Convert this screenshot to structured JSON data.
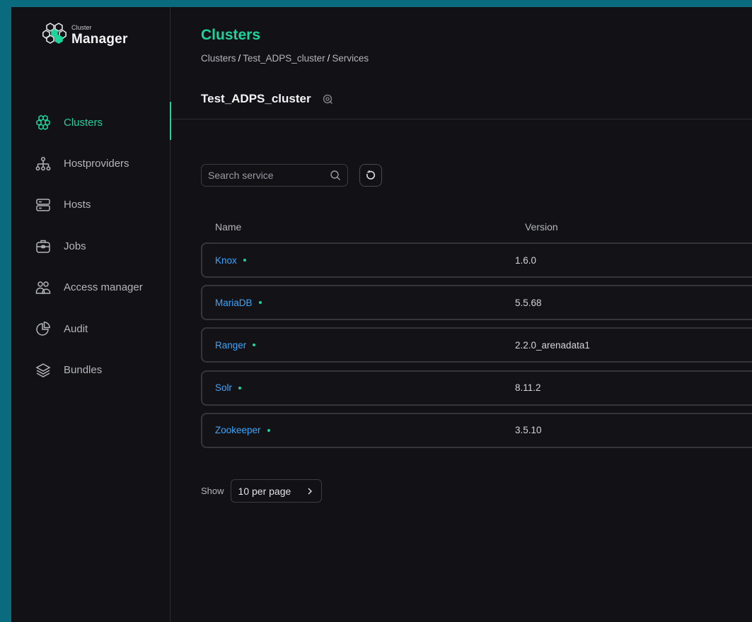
{
  "app": {
    "logo_small": "Cluster",
    "logo_big": "Manager"
  },
  "sidebar": {
    "items": [
      {
        "label": "Clusters",
        "icon": "clusters-icon",
        "active": true
      },
      {
        "label": "Hostproviders",
        "icon": "hostproviders-icon",
        "active": false
      },
      {
        "label": "Hosts",
        "icon": "hosts-icon",
        "active": false
      },
      {
        "label": "Jobs",
        "icon": "jobs-icon",
        "active": false
      },
      {
        "label": "Access manager",
        "icon": "access-manager-icon",
        "active": false
      },
      {
        "label": "Audit",
        "icon": "audit-icon",
        "active": false
      },
      {
        "label": "Bundles",
        "icon": "bundles-icon",
        "active": false
      }
    ]
  },
  "header": {
    "title": "Clusters",
    "breadcrumb": [
      "Clusters",
      "Test_ADPS_cluster",
      "Services"
    ],
    "breadcrumb_sep": "/"
  },
  "cluster": {
    "name": "Test_ADPS_cluster"
  },
  "search": {
    "placeholder": "Search service"
  },
  "table": {
    "columns": [
      "Name",
      "Version"
    ],
    "rows": [
      {
        "name": "Knox",
        "version": "1.6.0"
      },
      {
        "name": "MariaDB",
        "version": "5.5.68"
      },
      {
        "name": "Ranger",
        "version": "2.2.0_arenadata1"
      },
      {
        "name": "Solr",
        "version": "8.11.2"
      },
      {
        "name": "Zookeeper",
        "version": "3.5.10"
      }
    ]
  },
  "pagination": {
    "show_label": "Show",
    "per_page": "10 per page"
  },
  "colors": {
    "accent": "#1ed39b",
    "link": "#3aa6ff",
    "background": "#111116",
    "border": "#35353c"
  }
}
